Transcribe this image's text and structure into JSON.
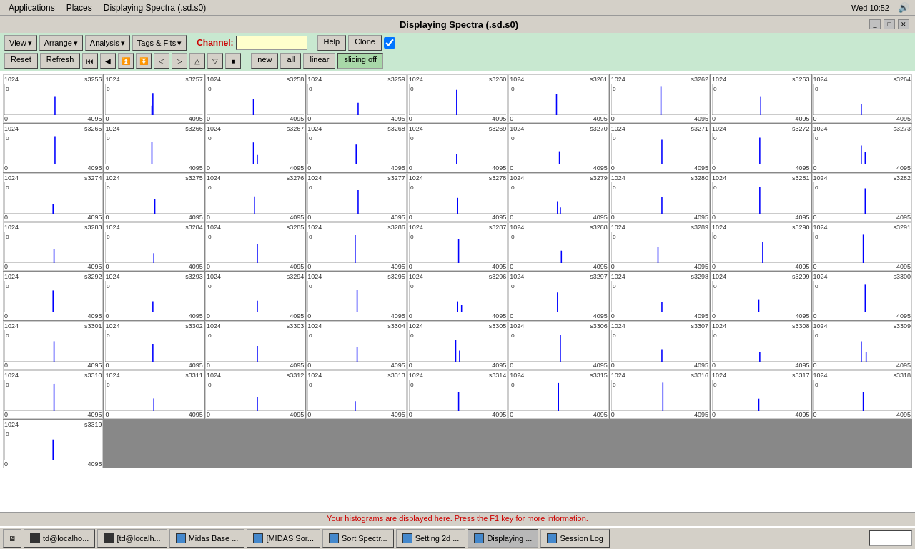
{
  "system": {
    "time": "Wed 10:52",
    "sound_icon": "🔊"
  },
  "menubar": {
    "items": [
      "Applications",
      "Places",
      "Displaying Spectra (.sd.s0)"
    ]
  },
  "window": {
    "title": "Displaying Spectra (.sd.s0)",
    "app_title": "Displaying Spectra (.sd.s0)"
  },
  "toolbar": {
    "row1": {
      "view_label": "View",
      "arrange_label": "Arrange",
      "analysis_label": "Analysis",
      "tags_fits_label": "Tags & Fits",
      "channel_label": "Channel:",
      "channel_value": "",
      "help_label": "Help",
      "clone_label": "Clone",
      "checkbox_checked": true
    },
    "row2": {
      "reset_label": "Reset",
      "refresh_label": "Refresh",
      "new_label": "new",
      "all_label": "all",
      "linear_label": "linear",
      "slicing_off_label": "slicing off"
    }
  },
  "spectra": {
    "y_max": "1024",
    "y_min": "0",
    "x_min": "0",
    "x_max": "4095",
    "cells": [
      {
        "id": "s3256"
      },
      {
        "id": "s3257"
      },
      {
        "id": "s3258"
      },
      {
        "id": "s3259"
      },
      {
        "id": "s3260"
      },
      {
        "id": "s3261"
      },
      {
        "id": "s3262"
      },
      {
        "id": "s3263"
      },
      {
        "id": "s3264"
      },
      {
        "id": "s3265"
      },
      {
        "id": "s3266"
      },
      {
        "id": "s3267"
      },
      {
        "id": "s3268"
      },
      {
        "id": "s3269"
      },
      {
        "id": "s3270"
      },
      {
        "id": "s3271"
      },
      {
        "id": "s3272"
      },
      {
        "id": "s3273"
      },
      {
        "id": "s3274"
      },
      {
        "id": "s3275"
      },
      {
        "id": "s3276"
      },
      {
        "id": "s3277"
      },
      {
        "id": "s3278"
      },
      {
        "id": "s3279"
      },
      {
        "id": "s3280"
      },
      {
        "id": "s3281"
      },
      {
        "id": "s3282"
      },
      {
        "id": "s3283"
      },
      {
        "id": "s3284"
      },
      {
        "id": "s3285"
      },
      {
        "id": "s3286"
      },
      {
        "id": "s3287"
      },
      {
        "id": "s3288"
      },
      {
        "id": "s3289"
      },
      {
        "id": "s3290"
      },
      {
        "id": "s3291"
      },
      {
        "id": "s3292"
      },
      {
        "id": "s3293"
      },
      {
        "id": "s3294"
      },
      {
        "id": "s3295"
      },
      {
        "id": "s3296"
      },
      {
        "id": "s3297"
      },
      {
        "id": "s3298"
      },
      {
        "id": "s3299"
      },
      {
        "id": "s3300"
      },
      {
        "id": "s3301"
      },
      {
        "id": "s3302"
      },
      {
        "id": "s3303"
      },
      {
        "id": "s3304"
      },
      {
        "id": "s3305"
      },
      {
        "id": "s3306"
      },
      {
        "id": "s3307"
      },
      {
        "id": "s3308"
      },
      {
        "id": "s3309"
      },
      {
        "id": "s3310"
      },
      {
        "id": "s3311"
      },
      {
        "id": "s3312"
      },
      {
        "id": "s3313"
      },
      {
        "id": "s3314"
      },
      {
        "id": "s3315"
      },
      {
        "id": "s3316"
      },
      {
        "id": "s3317"
      },
      {
        "id": "s3318"
      },
      {
        "id": "s3319"
      }
    ]
  },
  "statusbar": {
    "message": "Your histograms are displayed here. Press the F1 key for more information."
  },
  "taskbar": {
    "buttons": [
      {
        "label": "td@localho...",
        "icon": "term",
        "active": false
      },
      {
        "label": "[td@localh...",
        "icon": "term",
        "active": false
      },
      {
        "label": "Midas Base ...",
        "icon": "app",
        "active": false
      },
      {
        "label": "[MIDAS Sor...",
        "icon": "app",
        "active": false
      },
      {
        "label": "Sort Spectr...",
        "icon": "app",
        "active": false
      },
      {
        "label": "Setting 2d ...",
        "icon": "app",
        "active": false
      },
      {
        "label": "Displaying ...",
        "icon": "app",
        "active": true
      },
      {
        "label": "Session Log",
        "icon": "app",
        "active": false
      }
    ]
  }
}
